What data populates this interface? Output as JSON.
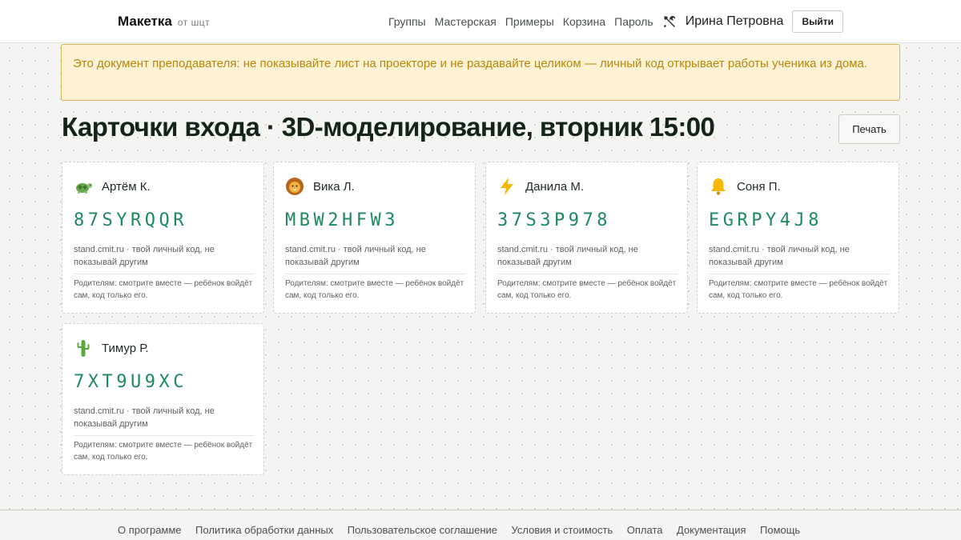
{
  "header": {
    "brand": "Макетка",
    "brand_sub": "от шцт",
    "nav": [
      "Группы",
      "Мастерская",
      "Примеры",
      "Корзина",
      "Пароль"
    ],
    "tools_icon": "tools-icon",
    "user_name": "Ирина Петровна",
    "logout_label": "Выйти"
  },
  "warning": "Это документ преподавателя: не показывайте лист на проекторе и не раздавайте целиком — личный код открывает работы ученика из дома.",
  "page": {
    "title": "Карточки входа · 3D-моделирование, вторник 15:00",
    "print_label": "Печать"
  },
  "cards": [
    {
      "name": "Артём К.",
      "icon": "turtle-icon",
      "code": "87SYRQQR"
    },
    {
      "name": "Вика Л.",
      "icon": "lion-icon",
      "code": "MBW2HFW3"
    },
    {
      "name": "Данила М.",
      "icon": "lightning-icon",
      "code": "37S3P978"
    },
    {
      "name": "Соня П.",
      "icon": "bell-icon",
      "code": "EGRPY4J8"
    },
    {
      "name": "Тимур Р.",
      "icon": "cactus-icon",
      "code": "7XT9U9XC"
    }
  ],
  "card_text": {
    "hint": "stand.cmit.ru · твой личный код, не показывай другим",
    "parents": "Родителям: смотрите вместе — ребёнок войдёт сам, код только его."
  },
  "footer": {
    "links": [
      "О программе",
      "Политика обработки данных",
      "Пользовательское соглашение",
      "Условия и стоимость",
      "Оплата",
      "Документация",
      "Помощь"
    ]
  },
  "colors": {
    "code": "#1d8a5c",
    "warning_bg": "#fdf2d3",
    "warning_text": "#b8860b",
    "warning_border": "#d8b35a"
  }
}
